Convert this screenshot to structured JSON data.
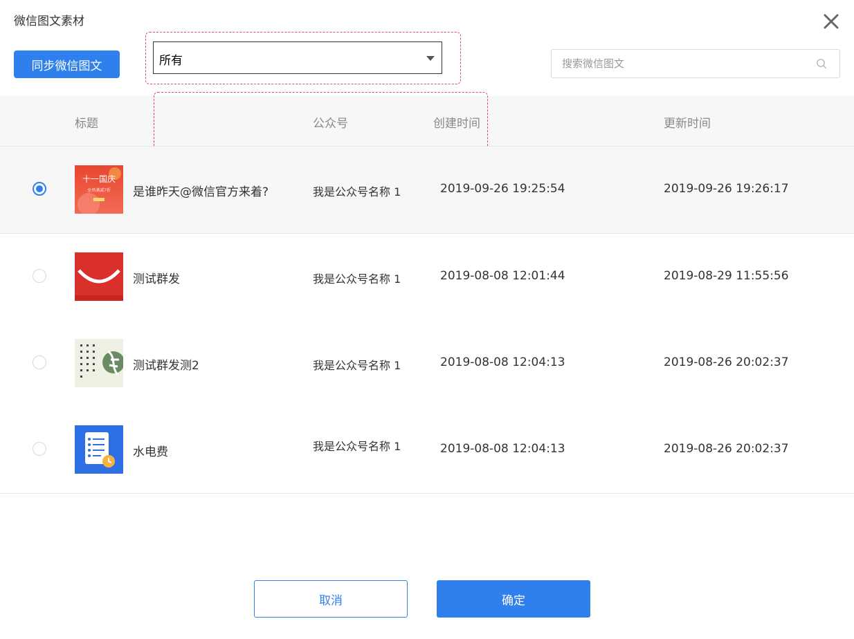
{
  "dialog": {
    "title": "微信图文素材"
  },
  "toolbar": {
    "sync_label": "同步微信图文",
    "filter_value": "所有",
    "search_placeholder": "搜索微信图文"
  },
  "table": {
    "headers": {
      "title": "标题",
      "account": "公众号",
      "created": "创建时间",
      "updated": "更新时间"
    },
    "rows": [
      {
        "selected": true,
        "thumb_icon": "national-day-poster-thumbnail",
        "thumb_text_1": "十一国庆",
        "thumb_text_2": "全场满减7折",
        "title": "是谁昨天@微信官方来着?",
        "account": "我是公众号名称 1",
        "created": "2019-09-26 19:25:54",
        "updated": "2019-09-26 19:26:17"
      },
      {
        "selected": false,
        "thumb_icon": "red-arc-thumbnail",
        "title": "测试群发",
        "account": "我是公众号名称 1",
        "created": "2019-08-08 12:01:44",
        "updated": "2019-08-29 11:55:56"
      },
      {
        "selected": false,
        "thumb_icon": "calligraphy-thumbnail",
        "title": "测试群发测2",
        "account": "我是公众号名称 1",
        "created": "2019-08-08 12:04:13",
        "updated": "2019-08-26 20:02:37"
      },
      {
        "selected": false,
        "thumb_icon": "checklist-clock-thumbnail",
        "title": "水电费",
        "account": "我是公众号名称 1",
        "created": "2019-08-08 12:04:13",
        "updated": "2019-08-26 20:02:37"
      }
    ]
  },
  "footer": {
    "cancel_label": "取消",
    "confirm_label": "确定"
  },
  "colors": {
    "primary": "#2f80ed",
    "annotation_dash": "#e0409a",
    "header_bg": "#f7f7f7"
  }
}
